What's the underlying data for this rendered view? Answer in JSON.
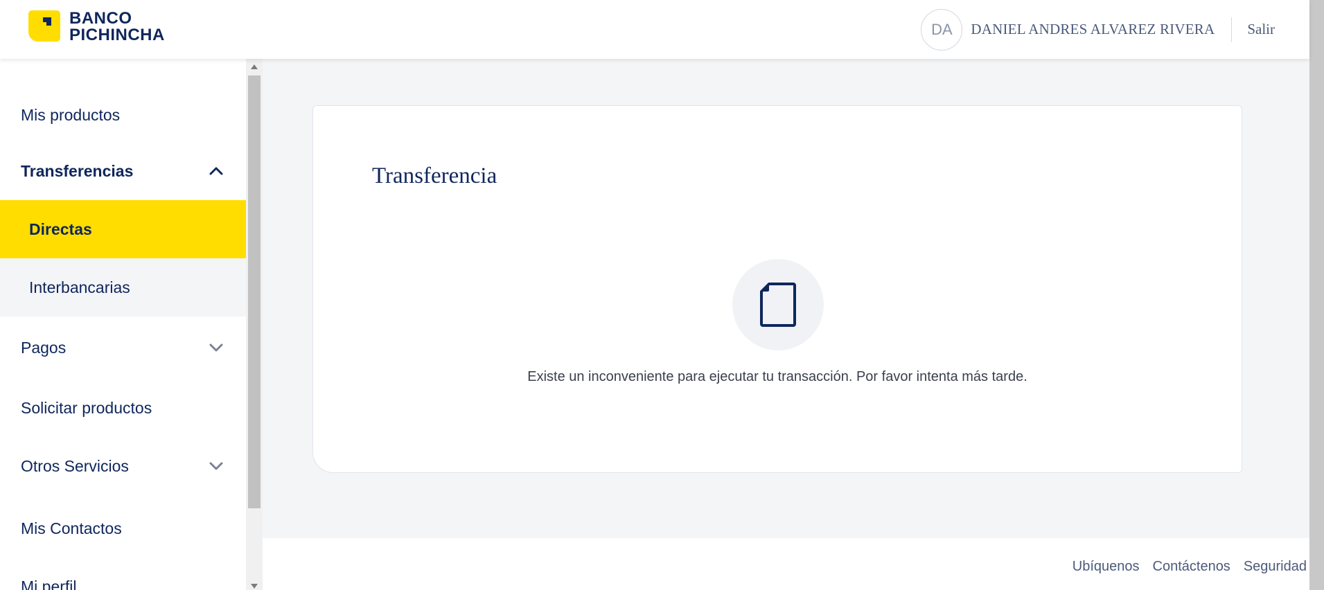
{
  "brand": {
    "line1": "BANCO",
    "line2": "PICHINCHA",
    "color_yellow": "#ffdd00",
    "color_navy": "#0f265c"
  },
  "user": {
    "initials": "DA",
    "name": "DANIEL ANDRES ALVAREZ RIVERA",
    "logout_label": "Salir"
  },
  "sidebar": {
    "items": [
      {
        "label": "Mis productos"
      },
      {
        "label": "Transferencias",
        "expanded": true,
        "icon": "chevron-up-icon"
      },
      {
        "label": "Directas",
        "active": true
      },
      {
        "label": "Interbancarias"
      },
      {
        "label": "Pagos",
        "icon": "chevron-down-icon"
      },
      {
        "label": "Solicitar productos"
      },
      {
        "label": "Otros Servicios",
        "icon": "chevron-down-icon"
      },
      {
        "label": "Mis Contactos"
      },
      {
        "label": "Mi perfil"
      }
    ]
  },
  "main": {
    "title": "Transferencia",
    "icon": "document-icon",
    "message": "Existe un inconveniente para ejecutar tu transacción. Por favor intenta más tarde."
  },
  "footer": {
    "links": [
      "Ubíquenos",
      "Contáctenos",
      "Seguridad"
    ]
  }
}
